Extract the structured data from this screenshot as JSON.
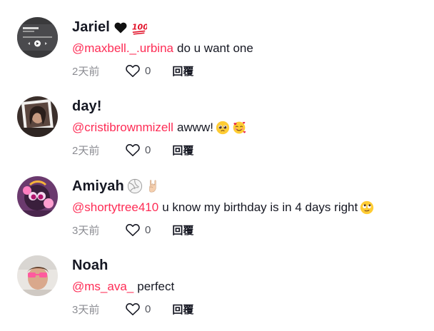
{
  "colors": {
    "mention": "#fe2c55",
    "text": "#161823",
    "muted": "#8a8b91"
  },
  "comments": [
    {
      "username": "Jariel",
      "name_emojis": [
        "black-heart-icon",
        "hundred-points-icon"
      ],
      "mention": "@maxbell._.urbina",
      "text": "do u want one",
      "text_emojis": [],
      "time": "2天前",
      "likes": "0",
      "reply_label": "回覆"
    },
    {
      "username": "day!",
      "name_emojis": [],
      "mention": "@cristibrownmizell",
      "text": "awww!",
      "text_emojis": [
        "pleading-face-icon",
        "smiling-face-with-hearts-icon"
      ],
      "time": "2天前",
      "likes": "0",
      "reply_label": "回覆"
    },
    {
      "username": "Amiyah",
      "name_emojis": [
        "volleyball-icon",
        "sign-of-horns-icon"
      ],
      "mention": "@shortytree410",
      "text": "u know my birthday is in 4 days right",
      "text_emojis": [
        "rolling-eyes-face-icon"
      ],
      "time": "3天前",
      "likes": "0",
      "reply_label": "回覆"
    },
    {
      "username": "Noah",
      "name_emojis": [],
      "mention": "@ms_ava_",
      "text": "perfect",
      "text_emojis": [],
      "time": "3天前",
      "likes": "0",
      "reply_label": "回覆"
    }
  ]
}
